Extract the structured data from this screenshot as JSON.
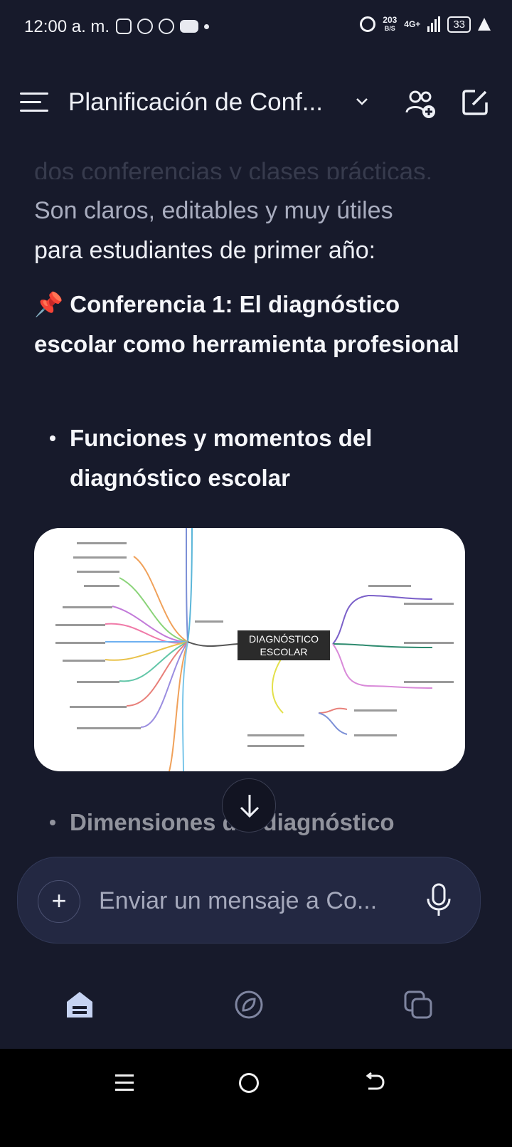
{
  "status_bar": {
    "time": "12:00 a. m.",
    "speed_value": "203",
    "speed_unit": "B/S",
    "network": "4G+",
    "battery": "33"
  },
  "app_bar": {
    "title": "Planificación de Conf..."
  },
  "chat": {
    "faded_line": "dos conferencias y clases prácticas.",
    "paragraph_dim": "Son claros, editables y muy útiles",
    "paragraph_rest": "para estudiantes de primer año:",
    "heading": "📌 Conferencia 1: El diagnóstico escolar como herramienta profesional",
    "bullets": [
      "Funciones y momentos del diagnóstico escolar",
      "Dimensiones del diagnóstico"
    ],
    "mindmap_center": [
      "DIAGNÓSTICO",
      "ESCOLAR"
    ]
  },
  "composer": {
    "placeholder": "Enviar un mensaje a Co..."
  },
  "colors": {
    "background": "#171a2b",
    "composer_bg": "#232842",
    "text": "#eef0f6"
  }
}
